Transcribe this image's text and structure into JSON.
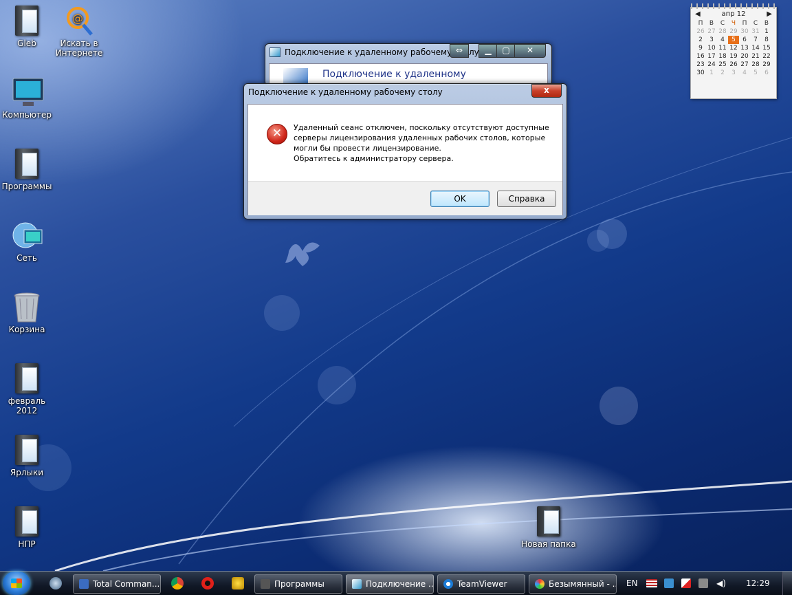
{
  "desktop": {
    "icons": [
      {
        "label": "Gleb"
      },
      {
        "label": "Искать в Интернете"
      },
      {
        "label": "Компьютер"
      },
      {
        "label": "Программы"
      },
      {
        "label": "Сеть"
      },
      {
        "label": "Корзина"
      },
      {
        "label": "февраль 2012"
      },
      {
        "label": "Ярлыки"
      },
      {
        "label": "НПР"
      },
      {
        "label": "Новая папка"
      }
    ]
  },
  "calendar": {
    "month": "апр 12",
    "weekdays": [
      "П",
      "В",
      "С",
      "Ч",
      "П",
      "С",
      "В"
    ],
    "weeks": [
      [
        "26",
        "27",
        "28",
        "29",
        "30",
        "31",
        "1"
      ],
      [
        "2",
        "3",
        "4",
        "5",
        "6",
        "7",
        "8"
      ],
      [
        "9",
        "10",
        "11",
        "12",
        "13",
        "14",
        "15"
      ],
      [
        "16",
        "17",
        "18",
        "19",
        "20",
        "21",
        "22"
      ],
      [
        "23",
        "24",
        "25",
        "26",
        "27",
        "28",
        "29"
      ],
      [
        "30",
        "1",
        "2",
        "3",
        "4",
        "5",
        "6"
      ]
    ],
    "today": "5"
  },
  "rdp_window": {
    "title": "Подключение к удаленному рабочему столу",
    "heading": "Подключение к удаленному"
  },
  "dialog": {
    "title": "Подключение к удаленному рабочему столу",
    "message_lines": [
      "Удаленный сеанс отключен, поскольку отсутствуют доступные",
      "серверы лицензирования удаленных рабочих столов, которые",
      "могли бы провести лицензирование.",
      "Обратитесь к администратору сервера."
    ],
    "ok_label": "OK",
    "help_label": "Справка",
    "close_label": "x"
  },
  "taskbar": {
    "items": [
      {
        "label": "Total Comman..."
      },
      {
        "label": "Программы"
      },
      {
        "label": "Подключение ..."
      },
      {
        "label": "TeamViewer"
      },
      {
        "label": "Безымянный - ..."
      }
    ],
    "language": "EN",
    "clock": "12:29"
  }
}
